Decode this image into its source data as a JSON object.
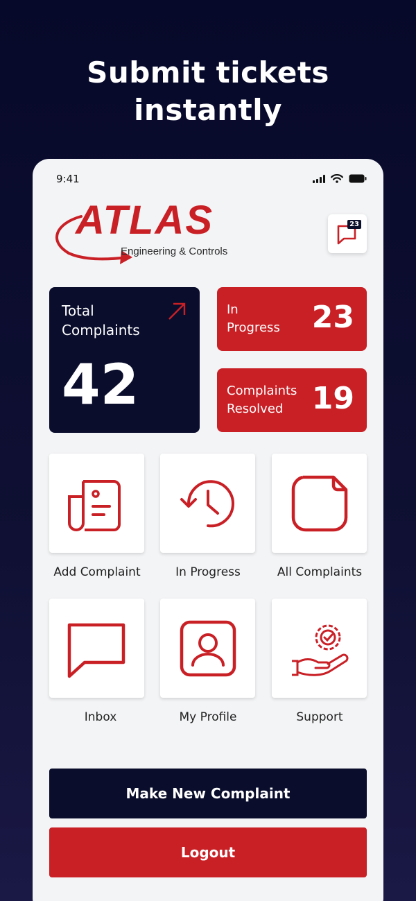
{
  "headline": {
    "line1": "Submit tickets",
    "line2": "instantly"
  },
  "status_bar": {
    "time": "9:41"
  },
  "logo": {
    "brand": "ATLAS",
    "tagline": "Engineering & Controls"
  },
  "inbox_badge": "23",
  "stats": {
    "total_label": "Total Complaints",
    "total_value": "42",
    "in_progress_label_1": "In",
    "in_progress_label_2": "Progress",
    "in_progress_value": "23",
    "resolved_label_1": "Complaints",
    "resolved_label_2": "Resolved",
    "resolved_value": "19"
  },
  "menu": [
    {
      "label": "Add Complaint",
      "icon": "document-icon"
    },
    {
      "label": "In Progress",
      "icon": "history-icon"
    },
    {
      "label": "All Complaints",
      "icon": "note-icon"
    },
    {
      "label": "Inbox",
      "icon": "chat-icon"
    },
    {
      "label": "My Profile",
      "icon": "profile-icon"
    },
    {
      "label": "Support",
      "icon": "support-icon"
    }
  ],
  "actions": {
    "new_complaint": "Make New Complaint",
    "logout": "Logout"
  },
  "colors": {
    "accent": "#c92026",
    "navy": "#0a0d2c",
    "surface": "#f3f4f6"
  }
}
